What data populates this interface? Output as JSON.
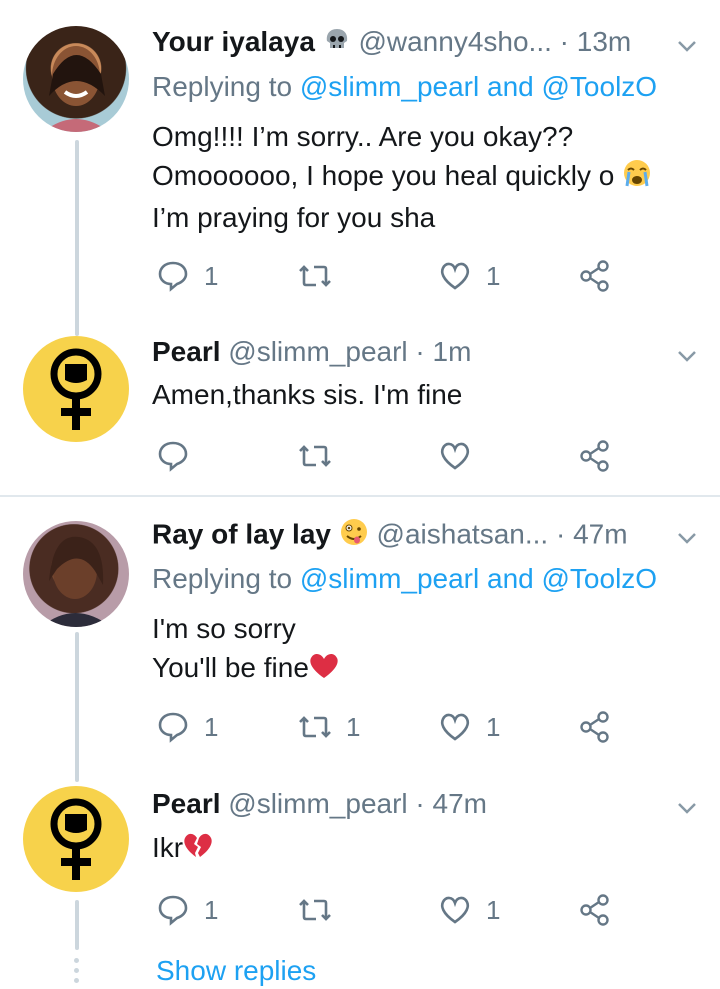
{
  "thread1": {
    "tweet": {
      "name": "Your iyalaya",
      "handle": "@wanny4sho...",
      "sep": "·",
      "time": "13m",
      "reply_prefix": "Replying to",
      "reply_users": "@slimm_pearl and @ToolzO",
      "line1": "Omg!!!! I’m sorry.. Are you okay??",
      "line2": "Omoooooo, I hope you heal quickly o",
      "line3": "I’m praying for you sha",
      "reply_count": "1",
      "retweet_count": "",
      "like_count": "1"
    },
    "reply": {
      "name": "Pearl",
      "handle": "@slimm_pearl",
      "sep": "·",
      "time": "1m",
      "line1": "Amen,thanks sis. I'm fine",
      "reply_count": "",
      "retweet_count": "",
      "like_count": ""
    }
  },
  "thread2": {
    "tweet": {
      "name": "Ray of lay lay",
      "handle": "@aishatsan...",
      "sep": "·",
      "time": "47m",
      "reply_prefix": "Replying to",
      "reply_users": "@slimm_pearl and @ToolzO",
      "line1": "I'm so sorry",
      "line2": "You'll be fine",
      "reply_count": "1",
      "retweet_count": "1",
      "like_count": "1"
    },
    "reply": {
      "name": "Pearl",
      "handle": "@slimm_pearl",
      "sep": "·",
      "time": "47m",
      "line1": "Ikr",
      "reply_count": "1",
      "retweet_count": "",
      "like_count": "1"
    },
    "show_replies": "Show replies"
  },
  "colors": {
    "link": "#1da1f2",
    "secondary": "#657786",
    "avatar_yellow": "#f7d24b"
  }
}
